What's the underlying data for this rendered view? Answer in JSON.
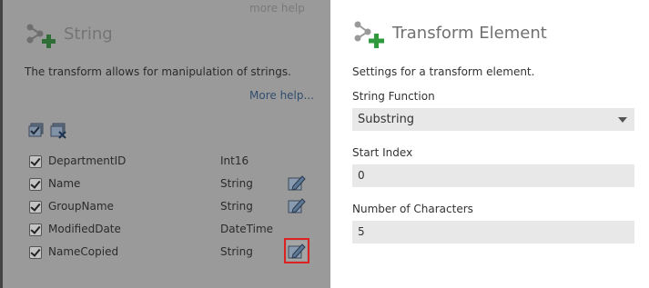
{
  "left_panel": {
    "more_help_top": "more help",
    "title": "String",
    "description": "The transform allows for manipulation of strings.",
    "more_help_link": "More help...",
    "fields": [
      {
        "name": "DepartmentID",
        "type": "Int16",
        "checked": true,
        "editable": false
      },
      {
        "name": "Name",
        "type": "String",
        "checked": true,
        "editable": true
      },
      {
        "name": "GroupName",
        "type": "String",
        "checked": true,
        "editable": true
      },
      {
        "name": "ModifiedDate",
        "type": "DateTime",
        "checked": true,
        "editable": false
      },
      {
        "name": "NameCopied",
        "type": "String",
        "checked": true,
        "editable": true,
        "highlighted": true
      }
    ]
  },
  "right_panel": {
    "title": "Transform Element",
    "description": "Settings for a transform element.",
    "string_function": {
      "label": "String Function",
      "value": "Substring"
    },
    "start_index": {
      "label": "Start Index",
      "value": "0"
    },
    "number_of_characters": {
      "label": "Number of Characters",
      "value": "5"
    }
  },
  "colors": {
    "accent_green": "#2e9a3c",
    "highlight_red": "#d22222",
    "link_blue": "#314e6e"
  }
}
